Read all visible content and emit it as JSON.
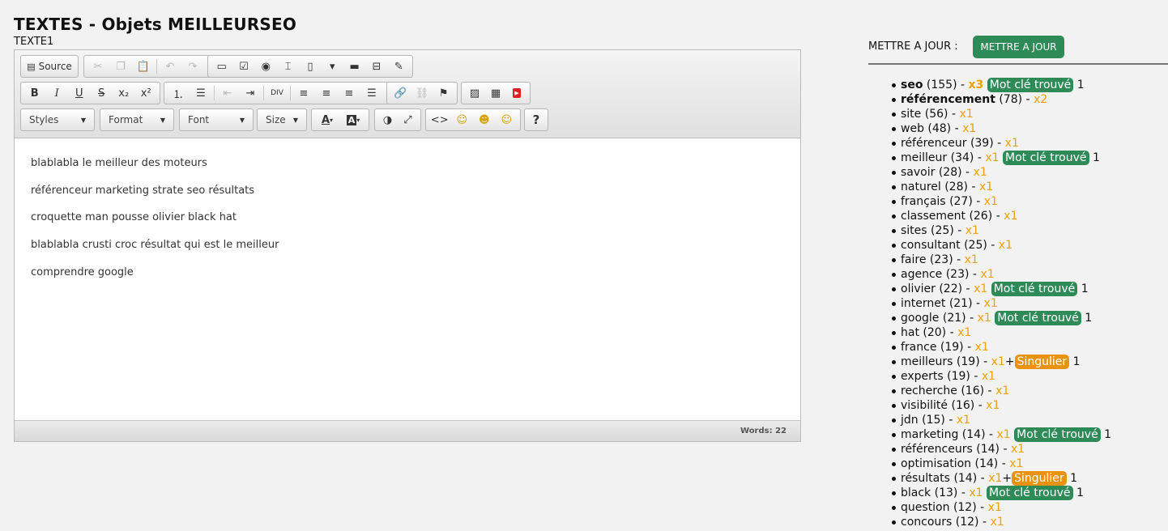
{
  "page": {
    "title": "TEXTES - Objets MEILLEURSEO",
    "subtitle": "TEXTE1"
  },
  "toolbar": {
    "source_label": "Source",
    "styles_label": "Styles",
    "format_label": "Format",
    "font_label": "Font",
    "size_label": "Size",
    "help_label": "?"
  },
  "editor": {
    "paragraphs": [
      "blablabla le meilleur des moteurs",
      "référenceur marketing strate seo résultats",
      "croquette man pousse olivier black hat",
      "blablabla crusti croc résultat qui est le meilleur",
      "comprendre google"
    ],
    "word_count": "Words: 22"
  },
  "update": {
    "label": "METTRE A JOUR :",
    "button": "METTRE A JOUR"
  },
  "keywords": [
    {
      "word": "seo",
      "count": "(155)",
      "sep": "-",
      "mult": "x3",
      "strong": true,
      "badge": "Mot clé trouvé",
      "badge_type": "green",
      "badge_count": "1"
    },
    {
      "word": "référencement",
      "count": "(78)",
      "sep": "-",
      "mult": "x2",
      "strong": true
    },
    {
      "word": "site",
      "count": "(56)",
      "sep": "-",
      "mult": "x1"
    },
    {
      "word": "web",
      "count": "(48)",
      "sep": "-",
      "mult": "x1"
    },
    {
      "word": "référenceur",
      "count": "(39)",
      "sep": "-",
      "mult": "x1"
    },
    {
      "word": "meilleur",
      "count": "(34)",
      "sep": "-",
      "mult": "x1",
      "badge": "Mot clé trouvé",
      "badge_type": "green",
      "badge_count": "1"
    },
    {
      "word": "savoir",
      "count": "(28)",
      "sep": "-",
      "mult": "x1"
    },
    {
      "word": "naturel",
      "count": "(28)",
      "sep": "-",
      "mult": "x1"
    },
    {
      "word": "français",
      "count": "(27)",
      "sep": "-",
      "mult": "x1"
    },
    {
      "word": "classement",
      "count": "(26)",
      "sep": "-",
      "mult": "x1"
    },
    {
      "word": "sites",
      "count": "(25)",
      "sep": "-",
      "mult": "x1"
    },
    {
      "word": "consultant",
      "count": "(25)",
      "sep": "-",
      "mult": "x1"
    },
    {
      "word": "faire",
      "count": "(23)",
      "sep": "-",
      "mult": "x1"
    },
    {
      "word": "agence",
      "count": "(23)",
      "sep": "-",
      "mult": "x1"
    },
    {
      "word": "olivier",
      "count": "(22)",
      "sep": "-",
      "mult": "x1",
      "badge": "Mot clé trouvé",
      "badge_type": "green",
      "badge_count": "1"
    },
    {
      "word": "internet",
      "count": "(21)",
      "sep": "-",
      "mult": "x1"
    },
    {
      "word": "google",
      "count": "(21)",
      "sep": "-",
      "mult": "x1",
      "badge": "Mot clé trouvé",
      "badge_type": "green",
      "badge_count": "1"
    },
    {
      "word": "hat",
      "count": "(20)",
      "sep": "-",
      "mult": "x1"
    },
    {
      "word": "france",
      "count": "(19)",
      "sep": "-",
      "mult": "x1"
    },
    {
      "word": "meilleurs",
      "count": "(19)",
      "sep": "-",
      "mult": "x1",
      "plus": "+",
      "badge": "Singulier",
      "badge_type": "orange",
      "badge_count": "1"
    },
    {
      "word": "experts",
      "count": "(19)",
      "sep": "-",
      "mult": "x1"
    },
    {
      "word": "recherche",
      "count": "(16)",
      "sep": "-",
      "mult": "x1"
    },
    {
      "word": "visibilité",
      "count": "(16)",
      "sep": "-",
      "mult": "x1"
    },
    {
      "word": "jdn",
      "count": "(15)",
      "sep": "-",
      "mult": "x1"
    },
    {
      "word": "marketing",
      "count": "(14)",
      "sep": "-",
      "mult": "x1",
      "badge": "Mot clé trouvé",
      "badge_type": "green",
      "badge_count": "1"
    },
    {
      "word": "référenceurs",
      "count": "(14)",
      "sep": "-",
      "mult": "x1"
    },
    {
      "word": "optimisation",
      "count": "(14)",
      "sep": "-",
      "mult": "x1"
    },
    {
      "word": "résultats",
      "count": "(14)",
      "sep": "-",
      "mult": "x1",
      "plus": "+",
      "badge": "Singulier",
      "badge_type": "orange",
      "badge_count": "1"
    },
    {
      "word": "black",
      "count": "(13)",
      "sep": "-",
      "mult": "x1",
      "badge": "Mot clé trouvé",
      "badge_type": "green",
      "badge_count": "1"
    },
    {
      "word": "question",
      "count": "(12)",
      "sep": "-",
      "mult": "x1"
    },
    {
      "word": "concours",
      "count": "(12)",
      "sep": "-",
      "mult": "x1"
    }
  ],
  "colors": {
    "accent_green": "#2e8b57",
    "accent_orange": "#e8920e",
    "mult_color": "#f0a000"
  }
}
